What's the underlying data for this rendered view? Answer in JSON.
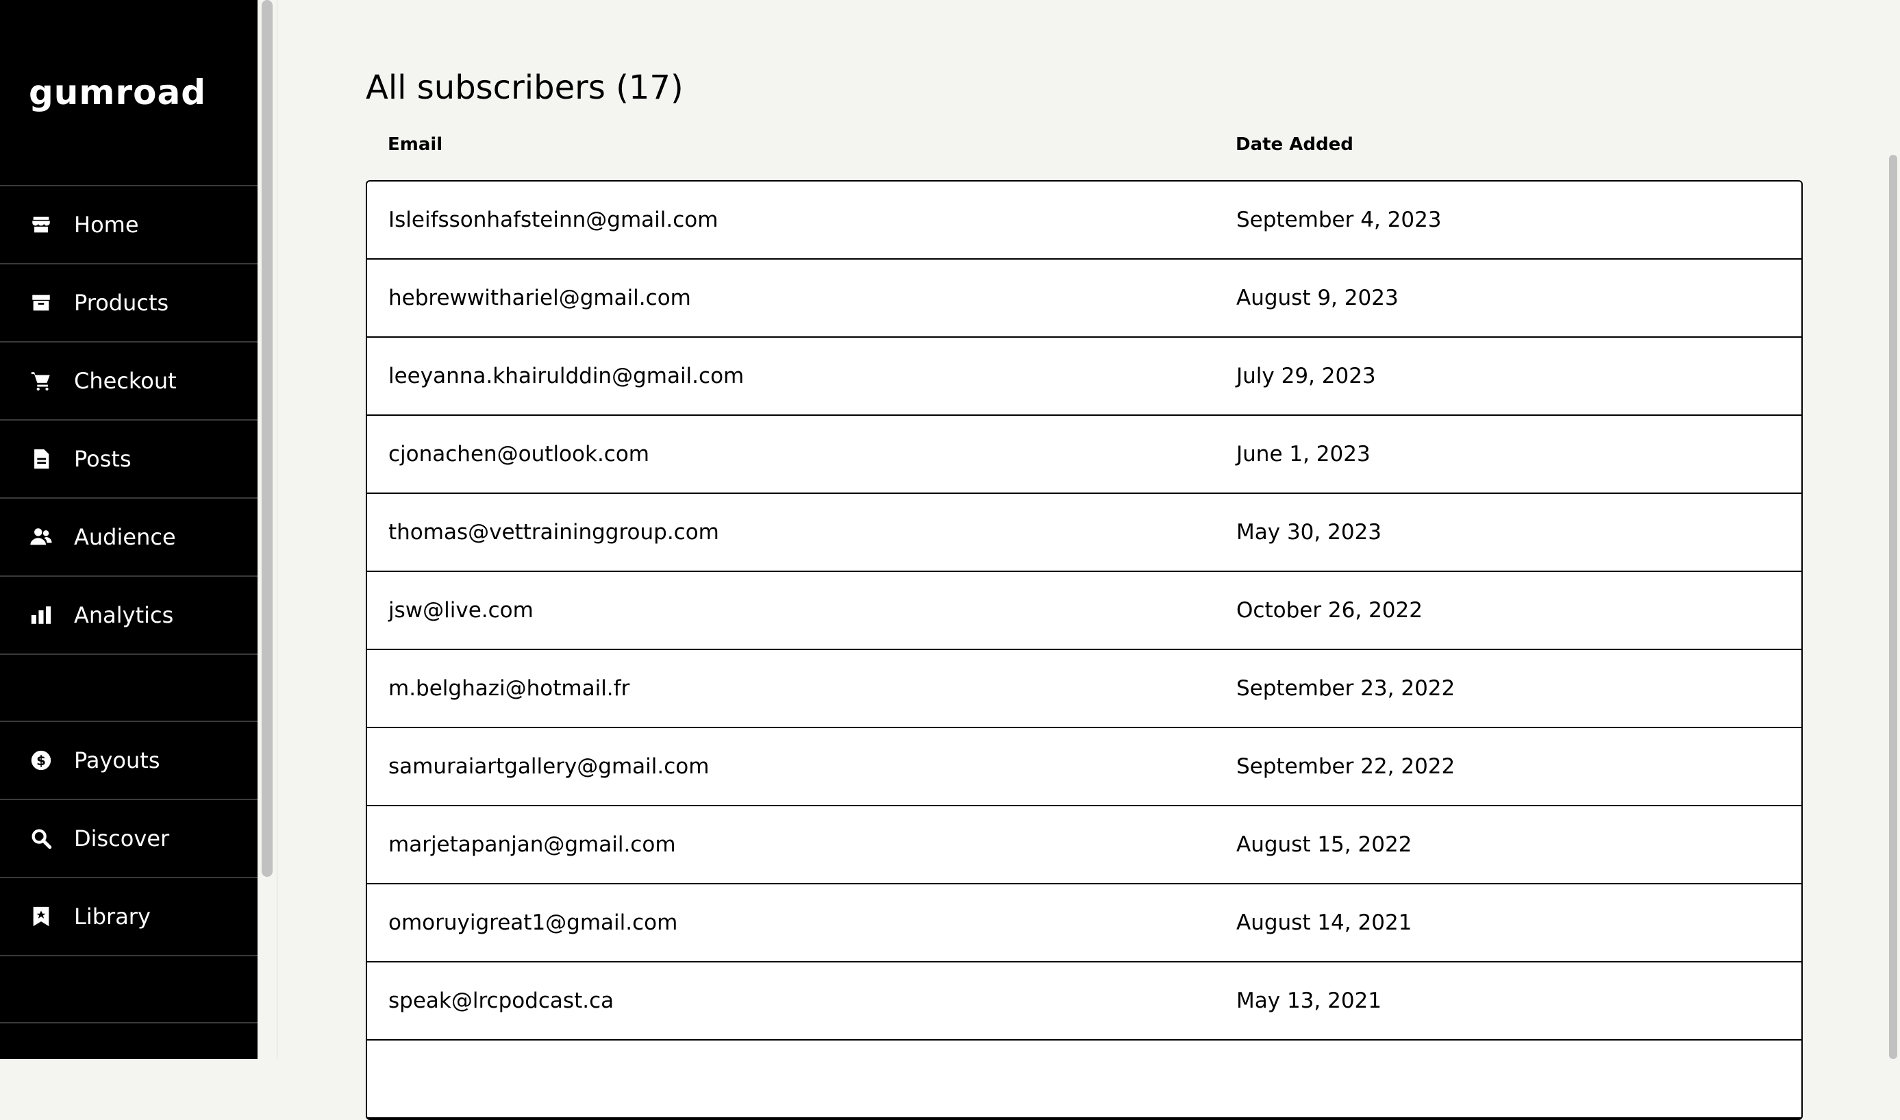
{
  "sidebar": {
    "logo": "gumroad",
    "nav_top": [
      {
        "label": "Home",
        "icon": "store-icon"
      },
      {
        "label": "Products",
        "icon": "archive-box-icon"
      },
      {
        "label": "Checkout",
        "icon": "cart-icon"
      },
      {
        "label": "Posts",
        "icon": "document-icon"
      },
      {
        "label": "Audience",
        "icon": "people-icon"
      },
      {
        "label": "Analytics",
        "icon": "bar-chart-icon"
      }
    ],
    "nav_bottom": [
      {
        "label": "Payouts",
        "icon": "dollar-circle-icon"
      },
      {
        "label": "Discover",
        "icon": "search-icon"
      },
      {
        "label": "Library",
        "icon": "bookmark-icon"
      }
    ]
  },
  "main": {
    "title": "All subscribers (17)",
    "columns": {
      "email": "Email",
      "date_added": "Date Added"
    },
    "rows": [
      {
        "email": "Isleifssonhafsteinn@gmail.com",
        "date": "September 4, 2023"
      },
      {
        "email": "hebrewwithariel@gmail.com",
        "date": "August 9, 2023"
      },
      {
        "email": "leeyanna.khairulddin@gmail.com",
        "date": "July 29, 2023"
      },
      {
        "email": "cjonachen@outlook.com",
        "date": "June 1, 2023"
      },
      {
        "email": "thomas@vettraininggroup.com",
        "date": "May 30, 2023"
      },
      {
        "email": "jsw@live.com",
        "date": "October 26, 2022"
      },
      {
        "email": "m.belghazi@hotmail.fr",
        "date": "September 23, 2022"
      },
      {
        "email": "samuraiartgallery@gmail.com",
        "date": "September 22, 2022"
      },
      {
        "email": "marjetapanjan@gmail.com",
        "date": "August 15, 2022"
      },
      {
        "email": "omoruyigreat1@gmail.com",
        "date": "August 14, 2021"
      },
      {
        "email": "speak@lrcpodcast.ca",
        "date": "May 13, 2021"
      },
      {
        "email": "",
        "date": ""
      }
    ]
  },
  "colors": {
    "sidebar_bg": "#000000",
    "page_bg": "#f4f4f0",
    "table_bg": "#ffffff",
    "border": "#000000"
  }
}
